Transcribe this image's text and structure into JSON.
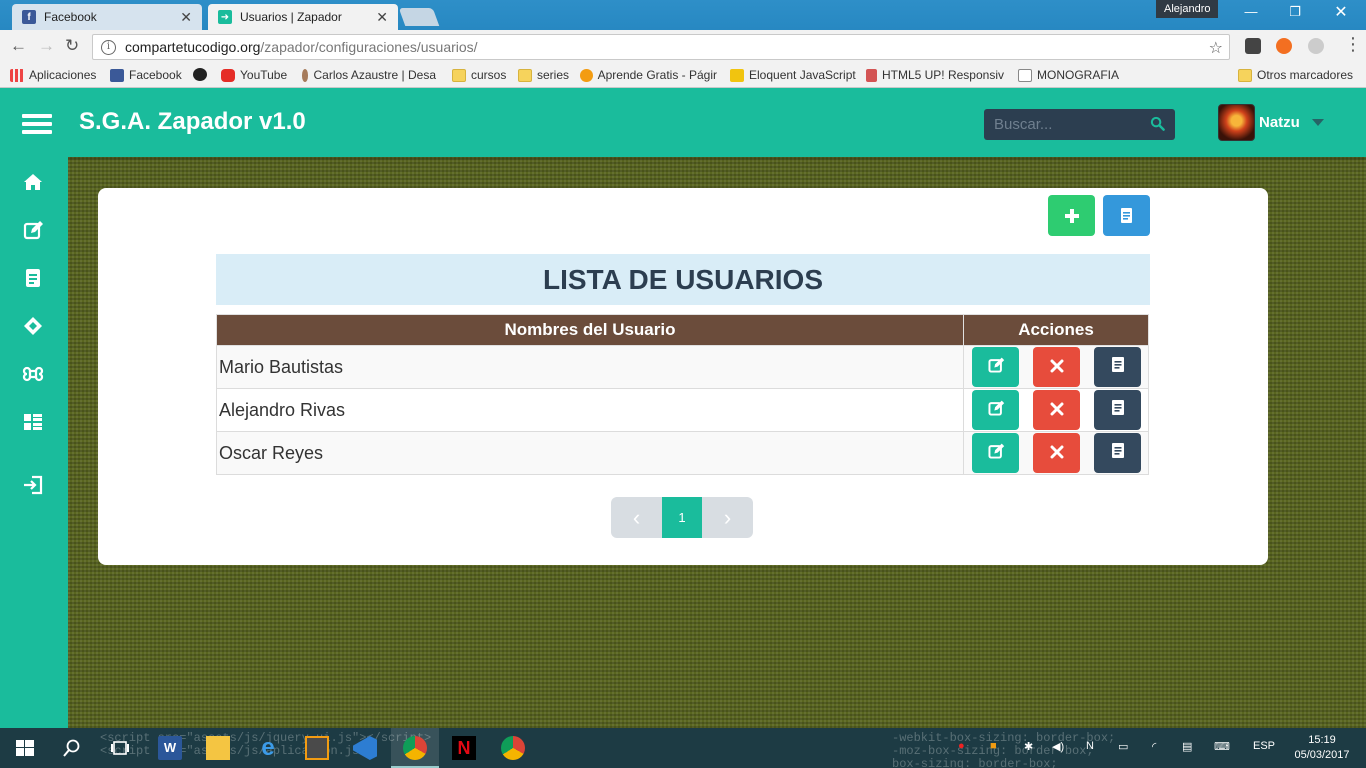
{
  "browser": {
    "tabs": [
      {
        "label": "Facebook",
        "favicon": "facebook-icon"
      },
      {
        "label": "Usuarios | Zapador",
        "favicon": "zapador-icon"
      }
    ],
    "profile_label": "Alejandro",
    "url_host": "compartetucodigo.org",
    "url_path": "/zapador/configuraciones/usuarios/",
    "bookmarks": [
      "Aplicaciones",
      "Facebook",
      "YouTube",
      "Carlos Azaustre | Desa",
      "cursos",
      "series",
      "Aprende Gratis - Págir",
      "Eloquent JavaScript",
      "HTML5 UP! Responsiv",
      "MONOGRAFIA"
    ],
    "other_bookmarks": "Otros marcadores"
  },
  "app": {
    "brand": "S.G.A. Zapador v1.0",
    "search_placeholder": "Buscar...",
    "user_name": "Natzu",
    "accent": "#1abc9c",
    "header_dark": "#2c3e50",
    "sidebar_icons": [
      "home-icon",
      "edit-icon",
      "document-icon",
      "ticket-icon",
      "command-icon",
      "list-icon",
      "logout-icon"
    ]
  },
  "page": {
    "title": "LISTA DE USUARIOS",
    "columns": [
      "Nombres del Usuario",
      "Acciones"
    ],
    "users": [
      "Mario Bautistas",
      "Alejandro Rivas",
      "Oscar Reyes"
    ],
    "current_page": "1",
    "colors": {
      "add": "#2ecc71",
      "report": "#3498db",
      "edit": "#1abc9c",
      "delete": "#e74c3c",
      "view": "#34495e",
      "table_header": "#6b4c3b",
      "title_bg": "#d9edf7"
    }
  },
  "taskbar": {
    "language": "ESP",
    "time": "15:19",
    "date": "05/03/2017"
  }
}
